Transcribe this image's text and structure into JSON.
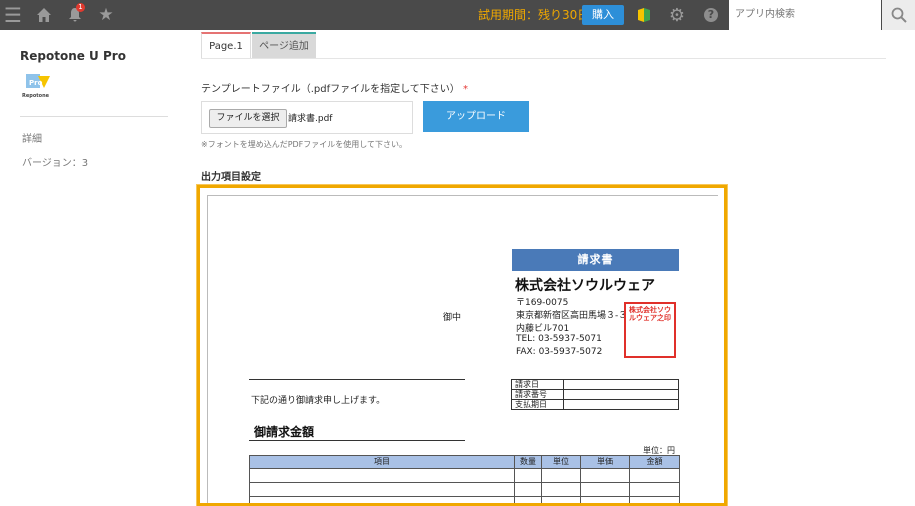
{
  "topbar": {
    "icons": [
      "menu-icon",
      "home-icon",
      "bell-icon",
      "star-icon",
      "leaf-icon",
      "gear-icon",
      "help-icon",
      "search-icon"
    ],
    "notification_count": "1",
    "trial_text": "試用期間：残り30日",
    "buy_label": "購入",
    "search_placeholder": "アプリ内検索",
    "colors": {
      "bar": "#4a4a4a",
      "trial": "#f0a800",
      "buy": "#2d8fd8"
    }
  },
  "sidebar": {
    "app_name": "Repotone U Pro",
    "logo_text": "Repotone",
    "logo_badge": "Pro",
    "detail_label": "詳細",
    "version_label": "バージョン：3"
  },
  "main": {
    "tabs": [
      {
        "label": "Page.1",
        "active": true
      },
      {
        "label": "ページ追加",
        "active": false
      }
    ],
    "template_label": "テンプレートファイル（.pdfファイルを指定して下さい）",
    "required_mark": "*",
    "file_button": "ファイルを選択",
    "file_name": "請求書.pdf",
    "upload_button": "アップロード",
    "note": "※フォントを埋め込んだPDFファイルを使用して下さい。",
    "output_label": "出力項目設定"
  },
  "preview": {
    "invoice_title": "請求書",
    "company": "株式会社ソウルウェア",
    "postal": "〒169-0075",
    "address1": "東京都新宿区高田馬場３-３",
    "address2": "内藤ビル701",
    "tel": "TEL: 03-5937-5071",
    "fax": "FAX: 03-5937-5072",
    "onchu": "御中",
    "seal_text": "株式会社ソウルウェア之印",
    "greeting": "下記の通り御請求申し上げます。",
    "amount_label": "御請求金額",
    "info_rows": [
      "請求日",
      "請求番号",
      "支払期日"
    ],
    "unit_note": "単位：円",
    "item_headers": [
      "項目",
      "数量",
      "単位",
      "単価",
      "金額"
    ],
    "colors": {
      "frame": "#f0a800",
      "title_bg": "#4a7ab8",
      "header_bg": "#a9c1e6",
      "seal": "#e0302a"
    }
  }
}
